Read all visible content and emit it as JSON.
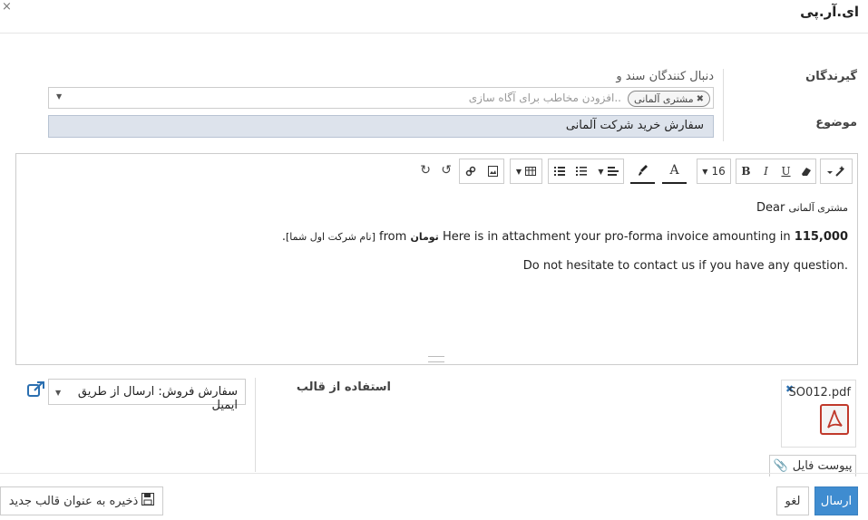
{
  "modal": {
    "title": "ای.آر.پی",
    "close_glyph": "×"
  },
  "form": {
    "recipients_label": "گیرندگان",
    "followers_label": "دنبال کنندگان سند و",
    "recipient_tag": "مشتری آلمانی",
    "recipient_tag_remove": "✖",
    "recipients_placeholder": "افزودن مخاطب برای آگاه سازی..",
    "subject_label": "موضوع",
    "subject_value": "سفارش خرید شرکت آلمانی"
  },
  "toolbar": {
    "font_size": "16",
    "bold": "B",
    "italic": "I",
    "underline": "U",
    "font_color": "A",
    "icons": [
      "magic-wand-icon",
      "eraser-icon",
      "paint-brush-icon",
      "unordered-list-icon",
      "ordered-list-icon",
      "align-icon",
      "table-icon",
      "link-icon",
      "picture-icon",
      "undo-icon",
      "redo-icon"
    ]
  },
  "body": {
    "greeting_word": "Dear",
    "greeting_name": "مشتری آلمانی",
    "line1_start": "Here is in attachment your pro-forma invoice amounting in ",
    "amount": "115,000",
    "currency": "تومان",
    "line1_mid": " from ",
    "company": "[نام شرکت اول شما]",
    "line1_end": ".",
    "line2": "Do not hesitate to contact us if you have any question."
  },
  "template": {
    "label": "استفاده از قالب",
    "selected": "سفارش فروش: ارسال از طریق ایمیل"
  },
  "attachment": {
    "filename": "SO012.pdf",
    "remove_glyph": "✖",
    "attach_label": "پیوست فایل"
  },
  "footer": {
    "send": "ارسال",
    "cancel": "لغو",
    "save_template": "ذخیره به عنوان قالب جدید"
  },
  "colors": {
    "primary": "#3f8cd0",
    "subject_bg": "#dde3ec",
    "pdf_red": "#c0392b",
    "link": "#2b6fb0"
  }
}
